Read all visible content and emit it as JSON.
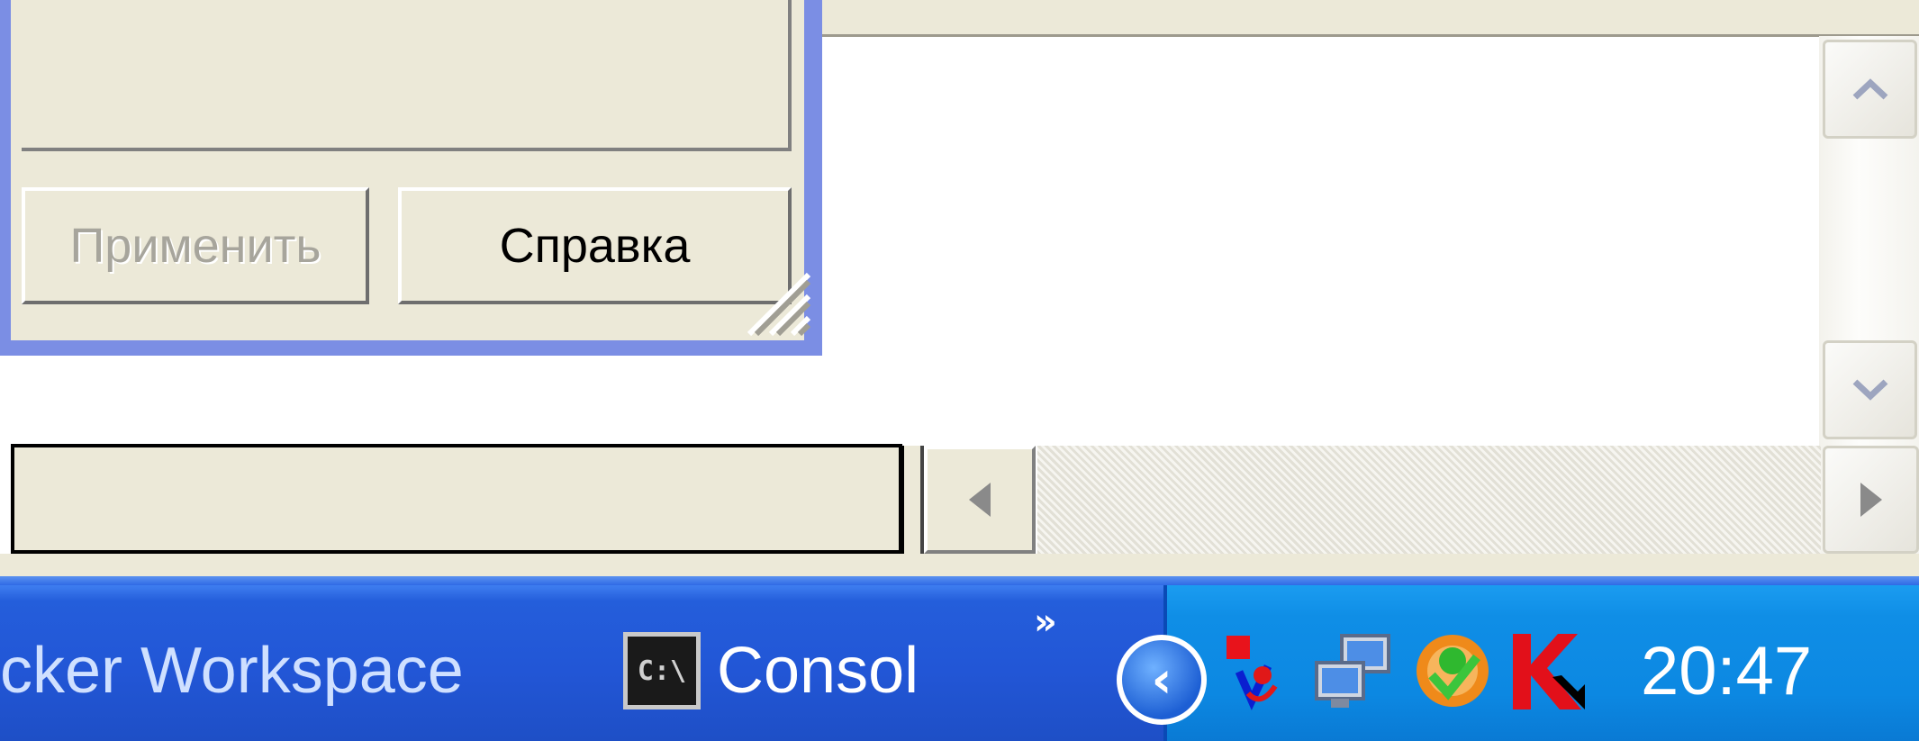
{
  "dialog": {
    "apply_label": "Применить",
    "help_label": "Справка"
  },
  "taskbar": {
    "tasks": [
      {
        "label": "cker Workspace",
        "icon": "app-icon"
      },
      {
        "label": "Consol",
        "icon": "console-icon",
        "icon_text": "C:\\"
      }
    ],
    "overflow_symbol": "»",
    "tray_expand_symbol": "‹",
    "tray_icons": [
      "network-alert-icon",
      "network-connections-icon",
      "antivirus-status-icon",
      "kaspersky-icon"
    ],
    "clock": "20:47"
  },
  "colors": {
    "dialog_border": "#7b8ee4",
    "window_face": "#ece9d8",
    "taskbar_blue": "#245edb",
    "tray_blue": "#0f8ee6"
  }
}
